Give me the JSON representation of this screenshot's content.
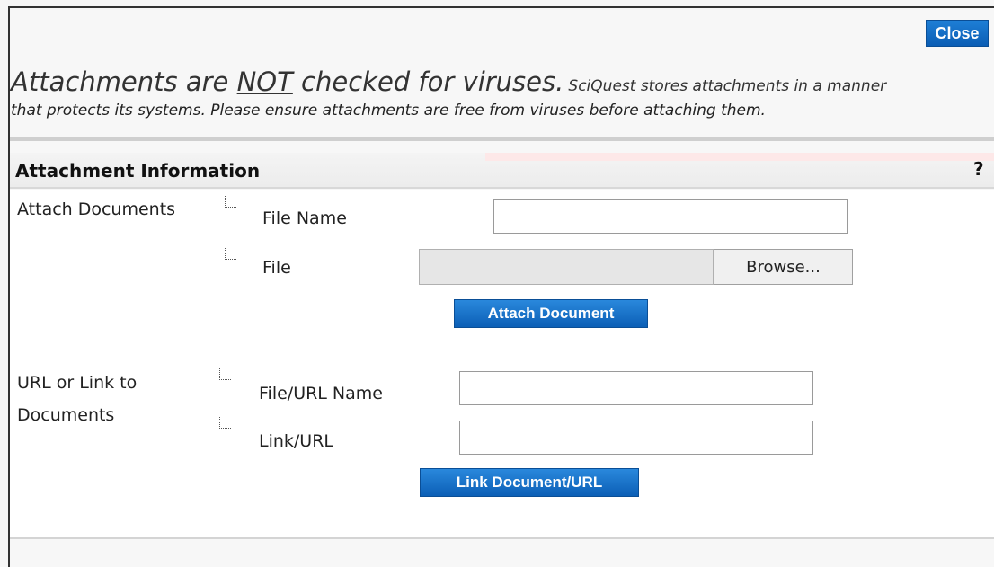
{
  "close_label": "Close",
  "warning": {
    "prefix": "Attachments are ",
    "emphasis": "NOT",
    "suffix": " checked for viruses.",
    "detail_line1": "SciQuest stores attachments in a manner",
    "detail_line2": "that protects its systems. Please ensure attachments are free from viruses before attaching them."
  },
  "section": {
    "title": "Attachment Information",
    "help": "?"
  },
  "attach": {
    "group_label": "Attach Documents",
    "file_name_label": "File Name",
    "file_name_value": "",
    "file_label": "File",
    "browse_label": "Browse...",
    "button_label": "Attach Document"
  },
  "link": {
    "group_label_line1": "URL or Link to",
    "group_label_line2": "Documents",
    "name_label": "File/URL Name",
    "name_value": "",
    "url_label": "Link/URL",
    "url_value": "",
    "button_label": "Link Document/URL"
  },
  "colors": {
    "button_blue": "#1a6fc8",
    "header_bg": "#efefef"
  }
}
